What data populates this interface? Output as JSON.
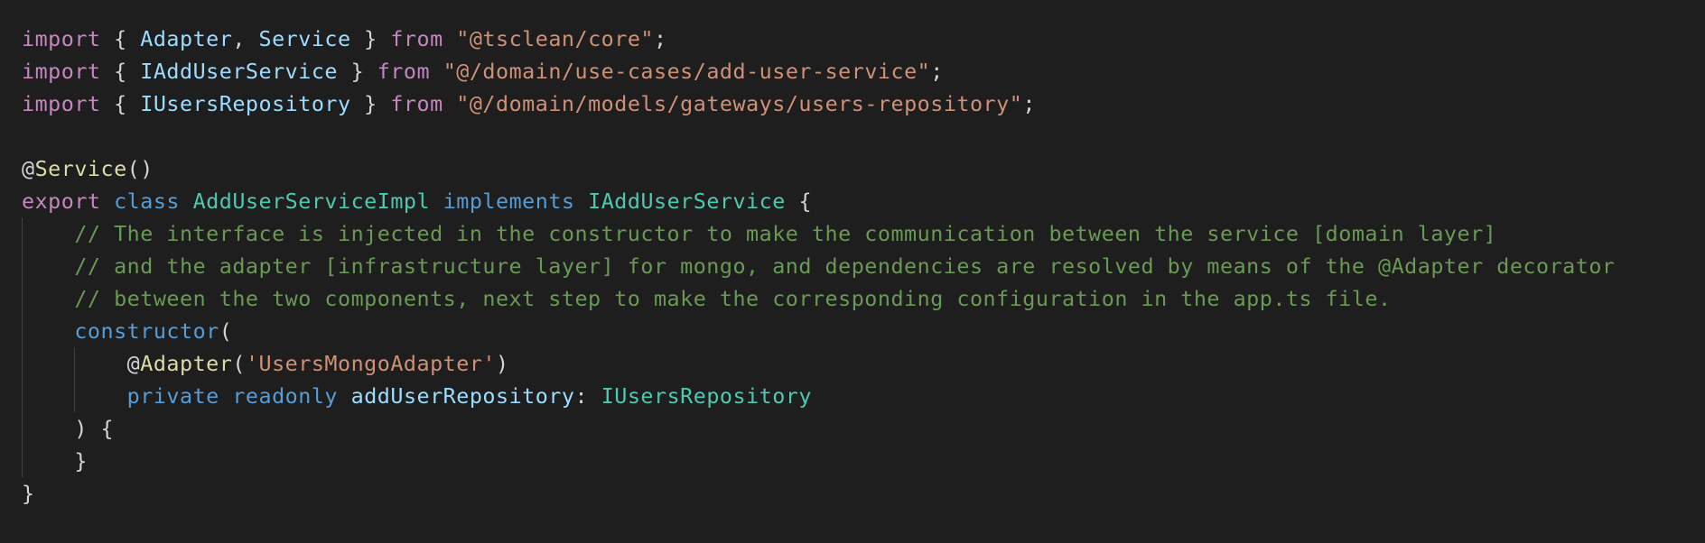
{
  "editor": {
    "language": "typescript",
    "theme": "dark",
    "lines": [
      [
        {
          "t": "import",
          "c": "kw"
        },
        {
          "t": " { ",
          "c": "pn"
        },
        {
          "t": "Adapter",
          "c": "id"
        },
        {
          "t": ", ",
          "c": "pn"
        },
        {
          "t": "Service",
          "c": "id"
        },
        {
          "t": " } ",
          "c": "pn"
        },
        {
          "t": "from",
          "c": "kw"
        },
        {
          "t": " ",
          "c": "pn"
        },
        {
          "t": "\"@tsclean/core\"",
          "c": "st"
        },
        {
          "t": ";",
          "c": "pn"
        }
      ],
      [
        {
          "t": "import",
          "c": "kw"
        },
        {
          "t": " { ",
          "c": "pn"
        },
        {
          "t": "IAddUserService",
          "c": "id"
        },
        {
          "t": " } ",
          "c": "pn"
        },
        {
          "t": "from",
          "c": "kw"
        },
        {
          "t": " ",
          "c": "pn"
        },
        {
          "t": "\"@/domain/use-cases/add-user-service\"",
          "c": "st"
        },
        {
          "t": ";",
          "c": "pn"
        }
      ],
      [
        {
          "t": "import",
          "c": "kw"
        },
        {
          "t": " { ",
          "c": "pn"
        },
        {
          "t": "IUsersRepository",
          "c": "id"
        },
        {
          "t": " } ",
          "c": "pn"
        },
        {
          "t": "from",
          "c": "kw"
        },
        {
          "t": " ",
          "c": "pn"
        },
        {
          "t": "\"@/domain/models/gateways/users-repository\"",
          "c": "st"
        },
        {
          "t": ";",
          "c": "pn"
        }
      ],
      [],
      [
        {
          "t": "@",
          "c": "pn"
        },
        {
          "t": "Service",
          "c": "fn"
        },
        {
          "t": "()",
          "c": "pn"
        }
      ],
      [
        {
          "t": "export",
          "c": "kw"
        },
        {
          "t": " ",
          "c": "pn"
        },
        {
          "t": "class",
          "c": "sk"
        },
        {
          "t": " ",
          "c": "pn"
        },
        {
          "t": "AddUserServiceImpl",
          "c": "ty"
        },
        {
          "t": " ",
          "c": "pn"
        },
        {
          "t": "implements",
          "c": "sk"
        },
        {
          "t": " ",
          "c": "pn"
        },
        {
          "t": "IAddUserService",
          "c": "ty"
        },
        {
          "t": " {",
          "c": "pn"
        }
      ],
      [
        {
          "t": "    ",
          "c": "pn"
        },
        {
          "t": "// The interface is injected in the constructor to make the communication between the service [domain layer]",
          "c": "cm"
        }
      ],
      [
        {
          "t": "    ",
          "c": "pn"
        },
        {
          "t": "// and the adapter [infrastructure layer] for mongo, and dependencies are resolved by means of the @Adapter decorator",
          "c": "cm"
        }
      ],
      [
        {
          "t": "    ",
          "c": "pn"
        },
        {
          "t": "// between the two components, next step to make the corresponding configuration in the app.ts file.",
          "c": "cm"
        }
      ],
      [
        {
          "t": "    ",
          "c": "pn"
        },
        {
          "t": "constructor",
          "c": "sk"
        },
        {
          "t": "(",
          "c": "pn"
        }
      ],
      [
        {
          "t": "        ",
          "c": "pn"
        },
        {
          "t": "@",
          "c": "pn"
        },
        {
          "t": "Adapter",
          "c": "fn"
        },
        {
          "t": "(",
          "c": "pn"
        },
        {
          "t": "'UsersMongoAdapter'",
          "c": "st"
        },
        {
          "t": ")",
          "c": "pn"
        }
      ],
      [
        {
          "t": "        ",
          "c": "pn"
        },
        {
          "t": "private",
          "c": "sk"
        },
        {
          "t": " ",
          "c": "pn"
        },
        {
          "t": "readonly",
          "c": "sk"
        },
        {
          "t": " ",
          "c": "pn"
        },
        {
          "t": "addUserRepository",
          "c": "id"
        },
        {
          "t": ": ",
          "c": "pn"
        },
        {
          "t": "IUsersRepository",
          "c": "ty"
        }
      ],
      [
        {
          "t": "    ",
          "c": "pn"
        },
        {
          "t": ") {",
          "c": "pn"
        }
      ],
      [
        {
          "t": "    ",
          "c": "pn"
        },
        {
          "t": "}",
          "c": "pn"
        }
      ],
      [
        {
          "t": "}",
          "c": "pn"
        }
      ]
    ]
  },
  "colors": {
    "background": "#1e1e1e",
    "keyword_control": "#c586c0",
    "keyword_storage": "#569cd6",
    "identifier": "#9cdcfe",
    "type": "#4ec9b0",
    "string": "#ce9178",
    "comment": "#6a9955",
    "decorator_function": "#dcdcaa",
    "punctuation": "#d4d4d4",
    "indent_guide": "#404040"
  }
}
